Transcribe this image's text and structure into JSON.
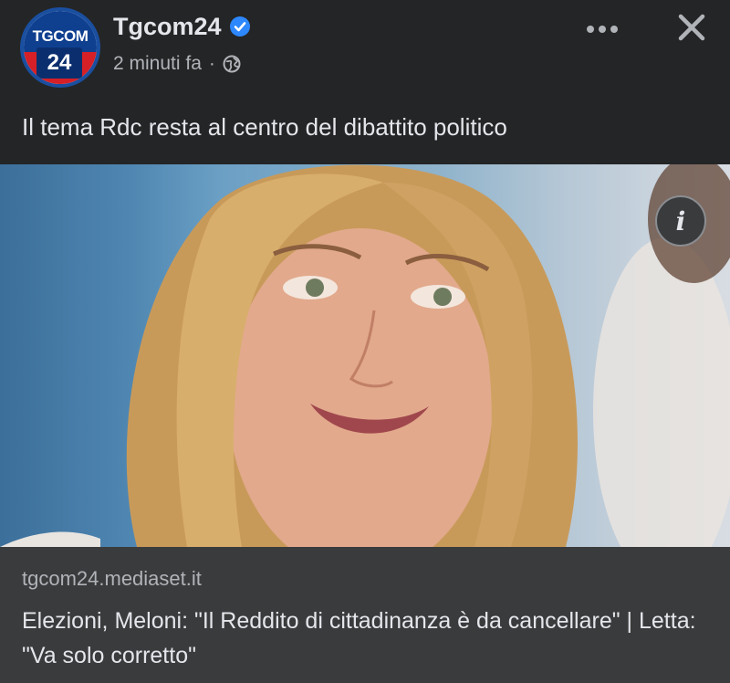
{
  "post": {
    "page_name": "Tgcom24",
    "avatar_top_text": "TGCOM",
    "avatar_number": "24",
    "time_ago": "2 minuti fa",
    "separator": "·",
    "caption": "Il tema Rdc resta al centro del dibattito politico"
  },
  "link": {
    "domain": "tgcom24.mediaset.it",
    "title": "Elezioni, Meloni: \"Il Reddito di cittadinanza è da cancellare\" | Letta: \"Va solo corretto\"",
    "info_glyph": "i"
  },
  "icons": {
    "verified": "verified-badge-icon",
    "globe": "globe-icon",
    "more": "more-horizontal-icon",
    "close": "close-icon",
    "info": "info-icon"
  },
  "colors": {
    "background": "#242526",
    "link_footer": "#3a3b3c",
    "verified_blue": "#2d88ff",
    "brand_blue": "#0f3f8f",
    "brand_red": "#d52027"
  }
}
